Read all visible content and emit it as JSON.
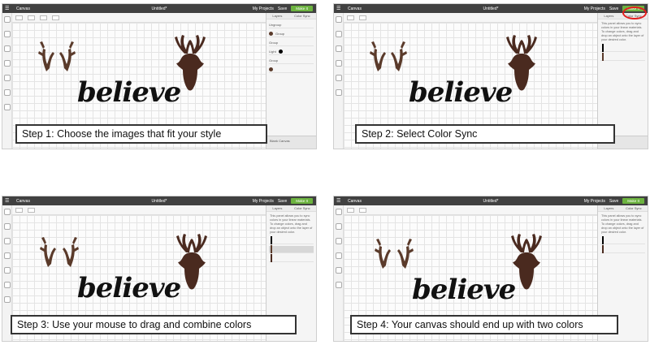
{
  "app": {
    "app_title": "Canvas",
    "doc_title": "Untitled*",
    "my_projects": "My Projects",
    "save": "Save",
    "make_it": "Make It"
  },
  "colors": {
    "topbar": "#414141",
    "make_button": "#6cb33f",
    "antler_brown": "#5a3a2a",
    "head_brown": "#4a2a1f",
    "highlight": "#e41e1e"
  },
  "panels": [
    {
      "caption": "Step 1: Choose the images that fit your style",
      "artwork_text": "believe",
      "right_panel": {
        "tabs": [
          "Layers",
          "Color Sync"
        ],
        "rows": [
          "Ungroup",
          "Group",
          "Group",
          "Light",
          "Group"
        ],
        "footer": "Blank Canvas"
      }
    },
    {
      "caption": "Step 2: Select Color Sync",
      "artwork_text": "believe",
      "right_panel": {
        "tabs": [
          "Layers",
          "Color Sync"
        ],
        "desc": "This panel allows you to sync colors in your linear materials. To change colors, drag and drop an object onto the layer of your desired color."
      }
    },
    {
      "caption": "Step 3: Use your mouse to drag and combine colors",
      "artwork_text": "believe",
      "right_panel": {
        "tabs": [
          "Layers",
          "Color Sync"
        ],
        "desc": "This panel allows you to sync colors in your linear materials. To change colors, drag and drop an object onto the layer of your desired color."
      }
    },
    {
      "caption": "Step 4: Your canvas should end up with two colors",
      "artwork_text": "believe",
      "right_panel": {
        "tabs": [
          "Layers",
          "Color Sync"
        ],
        "desc": "This panel allows you to sync colors in your linear materials. To change colors, drag and drop an object onto the layer of your desired color."
      }
    }
  ]
}
